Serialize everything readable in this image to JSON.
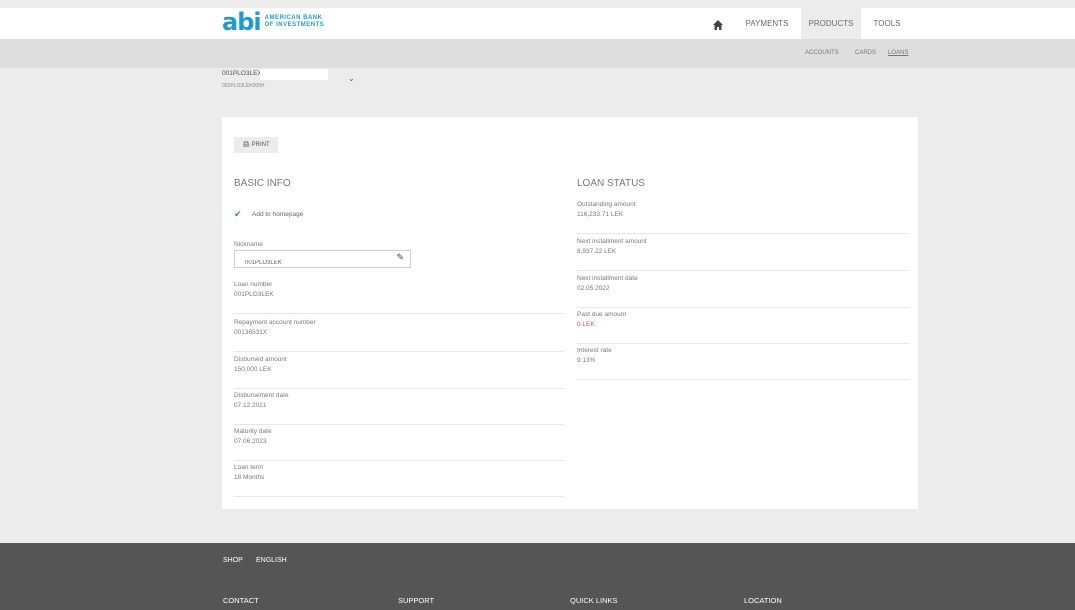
{
  "brand": {
    "logo_mark": "abi",
    "logo_text_line1": "AMERICAN BANK",
    "logo_text_line2": "OF INVESTMENTS",
    "accent_color": "#1e9bd1"
  },
  "nav": {
    "home_icon": "home-icon",
    "payments": "PAYMENTS",
    "products": "PRODUCTS",
    "tools": "TOOLS"
  },
  "subnav": {
    "accounts": "ACCOUNTS",
    "cards": "CARDS",
    "loans": "LOANS"
  },
  "account_selector": {
    "name": "001PLO3LEX",
    "number": "001PLO3LEK005H"
  },
  "card": {
    "print_label": "PRINT",
    "basic_info_title": "BASIC INFO",
    "loan_status_title": "LOAN STATUS",
    "add_to_homepage": "Add to homepage",
    "nickname_label": "Nickname",
    "nickname_value": "001PLO3LEK",
    "left_fields": [
      {
        "label": "Loan number",
        "value": "001PLO3LEK"
      },
      {
        "label": "Repayment account number",
        "value": "00136531X"
      },
      {
        "label": "Disbursed amount",
        "value": "150,000 LEK"
      },
      {
        "label": "Disbursement date",
        "value": "07.12.2021"
      },
      {
        "label": "Maturity date",
        "value": "07.06.2023"
      },
      {
        "label": "Loan term",
        "value": "18 Months"
      }
    ],
    "right_fields": [
      {
        "label": "Outstanding amount",
        "value": "116,233.71 LEK"
      },
      {
        "label": "Next installment amount",
        "value": "8,937.22 LEK"
      },
      {
        "label": "Next installment date",
        "value": "02.05.2022"
      },
      {
        "label": "Past due amount",
        "value": "0 LEK"
      },
      {
        "label": "Interest rate",
        "value": "9.13%"
      }
    ]
  },
  "footer": {
    "shop": "SHOP",
    "english": "ENGLISH",
    "contact": "CONTACT",
    "support": "SUPPORT",
    "quick_links": "QUICK LINKS",
    "location": "LOCATION"
  }
}
